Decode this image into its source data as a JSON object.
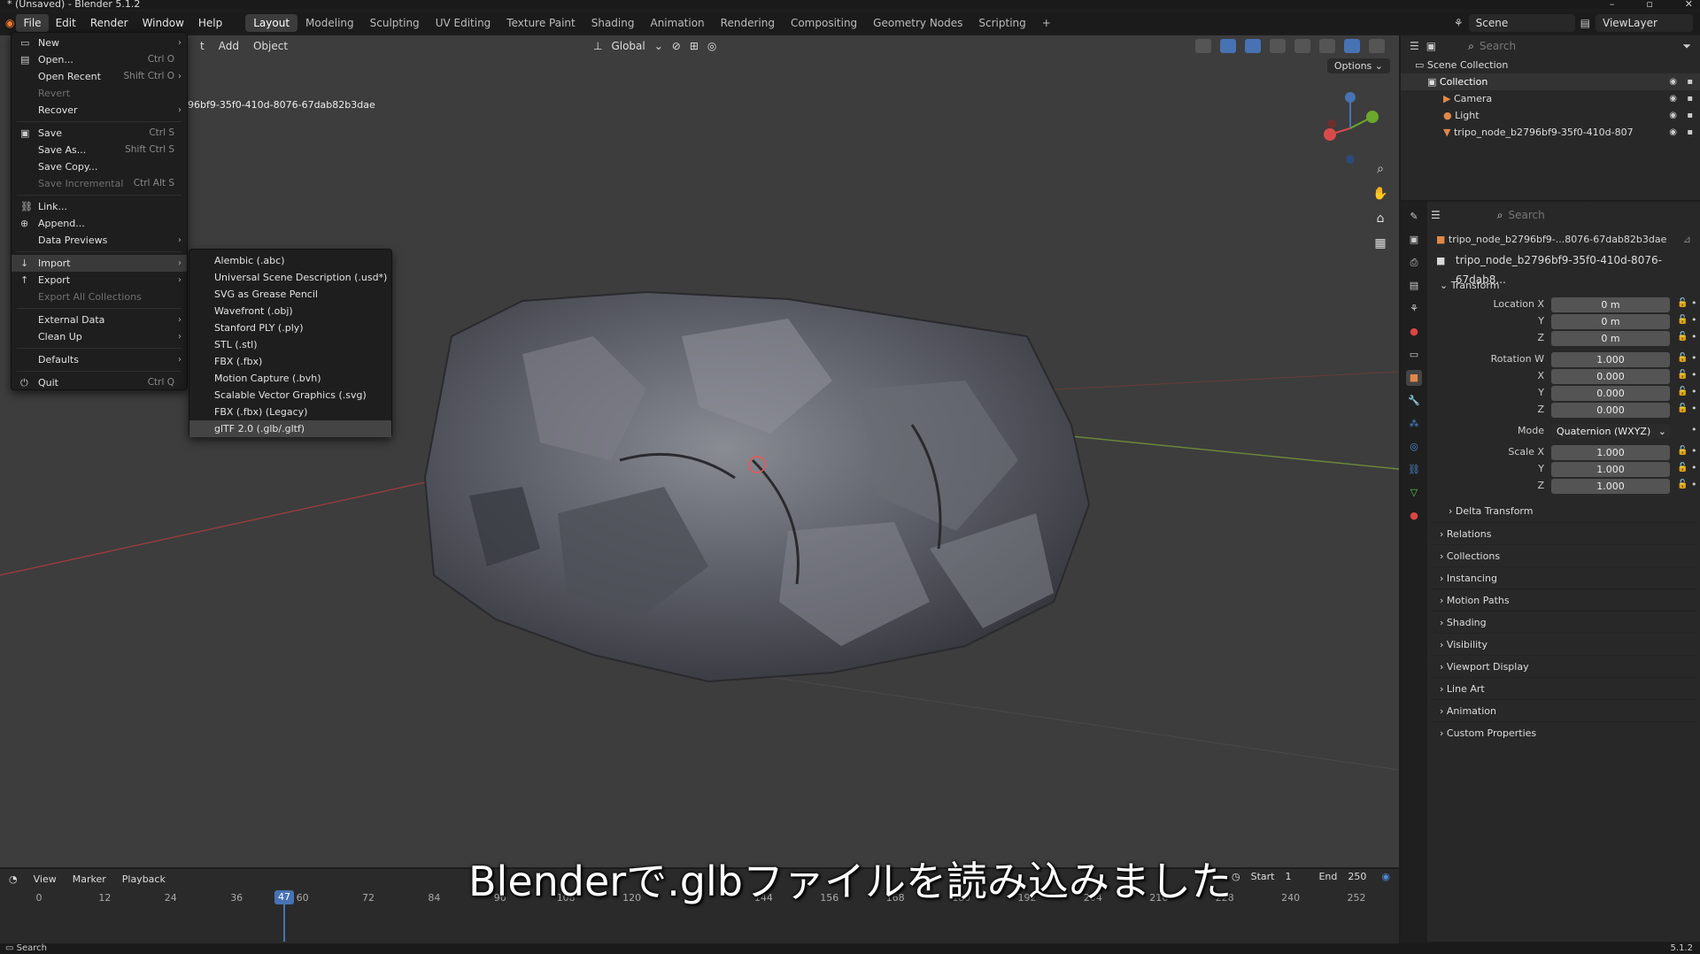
{
  "window": {
    "title": "* (Unsaved) - Blender 5.1.2"
  },
  "topbar": {
    "menus": [
      "File",
      "Edit",
      "Render",
      "Window",
      "Help"
    ],
    "tabs": [
      "Layout",
      "Modeling",
      "Sculpting",
      "UV Editing",
      "Texture Paint",
      "Shading",
      "Animation",
      "Rendering",
      "Compositing",
      "Geometry Nodes",
      "Scripting"
    ],
    "active_tab": "Layout",
    "add_tab": "+",
    "scene": "Scene",
    "view_layer": "ViewLayer"
  },
  "viewport": {
    "header_items": [
      "t",
      "Add",
      "Object"
    ],
    "orientation": "Global",
    "options": "Options",
    "object_name": "96bf9-35f0-410d-8076-67dab82b3dae"
  },
  "file_menu": {
    "items": [
      {
        "label": "New",
        "icon": "new-icon",
        "arrow": true
      },
      {
        "label": "Open...",
        "shortcut": "Ctrl O",
        "icon": "folder-icon"
      },
      {
        "label": "Open Recent",
        "shortcut": "Shift Ctrl O",
        "arrow": true
      },
      {
        "label": "Revert",
        "disabled": true
      },
      {
        "label": "Recover",
        "arrow": true
      },
      {
        "sep": true
      },
      {
        "label": "Save",
        "shortcut": "Ctrl S",
        "icon": "save-icon"
      },
      {
        "label": "Save As...",
        "shortcut": "Shift Ctrl S"
      },
      {
        "label": "Save Copy..."
      },
      {
        "label": "Save Incremental",
        "shortcut": "Ctrl Alt S",
        "disabled": true
      },
      {
        "sep": true
      },
      {
        "label": "Link...",
        "icon": "link-icon"
      },
      {
        "label": "Append...",
        "icon": "append-icon"
      },
      {
        "label": "Data Previews",
        "arrow": true
      },
      {
        "sep": true
      },
      {
        "label": "Import",
        "icon": "import-icon",
        "arrow": true,
        "highlight": true
      },
      {
        "label": "Export",
        "icon": "export-icon",
        "arrow": true
      },
      {
        "label": "Export All Collections",
        "disabled": true
      },
      {
        "sep": true
      },
      {
        "label": "External Data",
        "arrow": true
      },
      {
        "label": "Clean Up",
        "arrow": true
      },
      {
        "sep": true
      },
      {
        "label": "Defaults",
        "arrow": true
      },
      {
        "sep": true
      },
      {
        "label": "Quit",
        "shortcut": "Ctrl Q",
        "icon": "power-icon"
      }
    ]
  },
  "import_menu": {
    "items": [
      "Alembic (.abc)",
      "Universal Scene Description (.usd*)",
      "SVG as Grease Pencil",
      "Wavefront (.obj)",
      "Stanford PLY (.ply)",
      "STL (.stl)",
      "FBX (.fbx)",
      "Motion Capture (.bvh)",
      "Scalable Vector Graphics (.svg)",
      "FBX (.fbx) (Legacy)",
      "glTF 2.0 (.glb/.gltf)"
    ],
    "highlight_index": 10
  },
  "outliner": {
    "search_placeholder": "Search",
    "scene_collection": "Scene Collection",
    "collection": "Collection",
    "objects": [
      "Camera",
      "Light",
      "tripo_node_b2796bf9-35f0-410d-807"
    ]
  },
  "properties": {
    "search_placeholder": "Search",
    "object_path": "tripo_node_b2796bf9-...8076-67dab82b3dae",
    "object_name": "tripo_node_b2796bf9-35f0-410d-8076-67dab8...",
    "transform": {
      "title": "Transform",
      "location_label": "Location X",
      "location": [
        "0 m",
        "0 m",
        "0 m"
      ],
      "rotation_label": "Rotation W",
      "rotation": [
        "1.000",
        "0.000",
        "0.000",
        "0.000"
      ],
      "mode_label": "Mode",
      "mode": "Quaternion (WXYZ)",
      "scale_label": "Scale X",
      "scale": [
        "1.000",
        "1.000",
        "1.000"
      ],
      "axis_y": "Y",
      "axis_z": "Z",
      "axis_x": "X",
      "delta": "Delta Transform"
    },
    "panels": [
      "Relations",
      "Collections",
      "Instancing",
      "Motion Paths",
      "Shading",
      "Visibility",
      "Viewport Display",
      "Line Art",
      "Animation",
      "Custom Properties"
    ]
  },
  "timeline": {
    "menus": [
      "View",
      "Marker",
      "Playback"
    ],
    "current_frame": "47",
    "ticks": [
      "0",
      "12",
      "24",
      "36",
      "60",
      "72",
      "84",
      "96",
      "108",
      "120",
      "1",
      "144",
      "156",
      "168",
      "180",
      "192",
      "204",
      "216",
      "228",
      "240",
      "252"
    ],
    "start_label": "Start",
    "start": "1",
    "end_label": "End",
    "end": "250"
  },
  "statusbar": {
    "left": "Search",
    "right": "5.1.2"
  },
  "subtitle": "Blenderで.glbファイルを読み込みました"
}
